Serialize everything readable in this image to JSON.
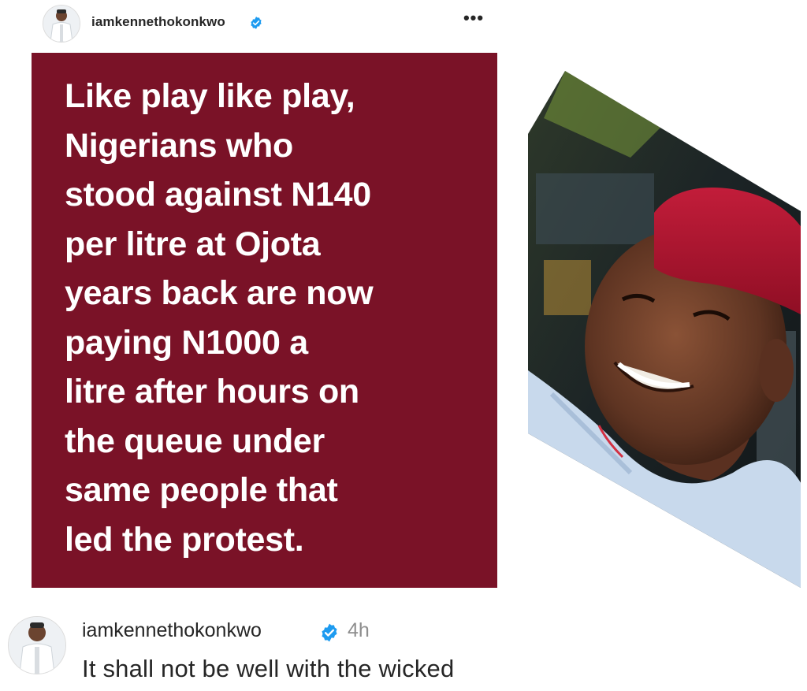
{
  "header": {
    "username": "iamkennethokonkwo",
    "more_label": "•••",
    "verified_icon": "verified-badge-icon",
    "avatar_icon": "profile-avatar"
  },
  "card": {
    "text": "Like play like play,\nNigerians who\nstood against N140\nper litre at Ojota\nyears back are now\npaying N1000 a\nlitre after hours on\nthe queue under\nsame people that\nled the protest.",
    "background_color": "#7a1227",
    "text_color": "#ffffff"
  },
  "photo": {
    "icon": "man-in-red-cap-photo"
  },
  "comment": {
    "username": "iamkennethokonkwo",
    "time": "4h",
    "text": "It shall not be well with the wicked",
    "verified_color": "#1d9bf0"
  }
}
